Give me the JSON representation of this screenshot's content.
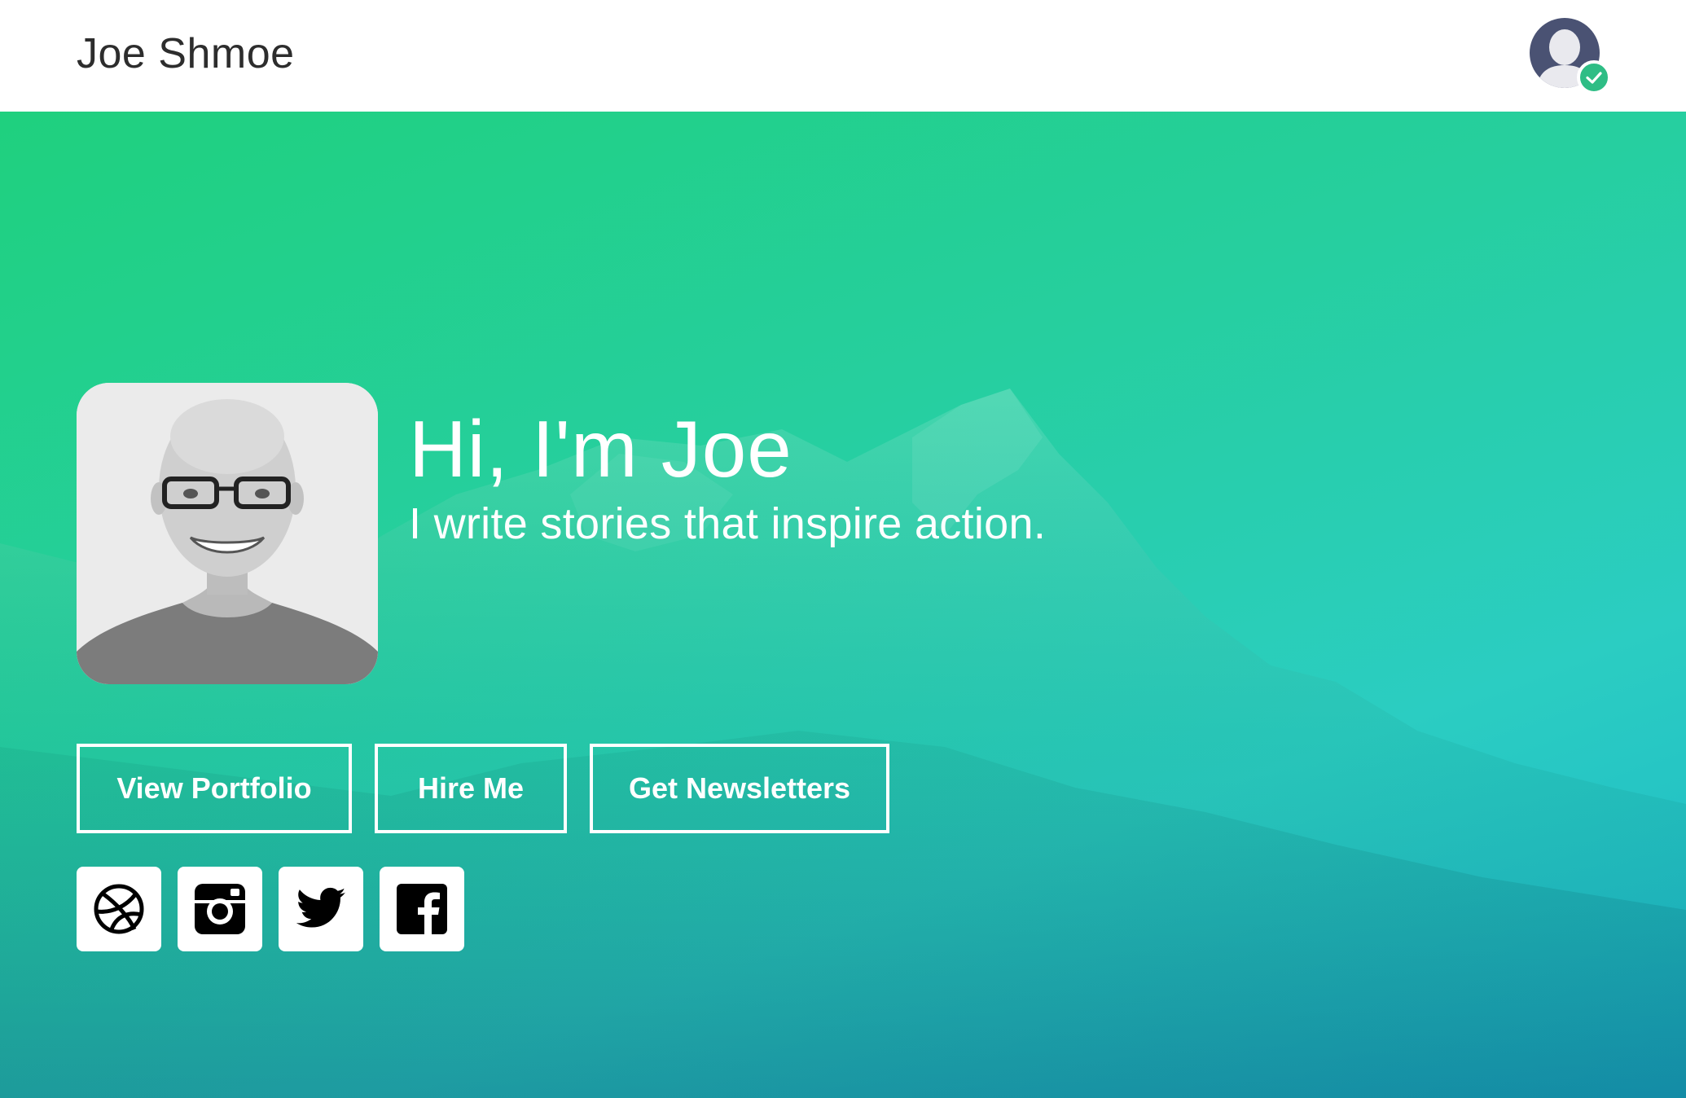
{
  "header": {
    "site_title": "Joe Shmoe",
    "user_avatar_icon": "user-avatar-icon",
    "verified_icon": "check-circle-icon"
  },
  "hero": {
    "heading": "Hi, I'm Joe",
    "tagline": "I write stories that inspire action.",
    "buttons": [
      {
        "label": "View Portfolio"
      },
      {
        "label": "Hire Me"
      },
      {
        "label": "Get Newsletters"
      }
    ],
    "social_links": [
      {
        "icon": "dribbble-icon"
      },
      {
        "icon": "instagram-icon"
      },
      {
        "icon": "twitter-icon"
      },
      {
        "icon": "facebook-icon"
      }
    ]
  },
  "colors": {
    "gradient_start": "#1fd07e",
    "gradient_end": "#1bb6c9",
    "badge_green": "#2ebd85",
    "avatar_navy": "#4a5273"
  }
}
